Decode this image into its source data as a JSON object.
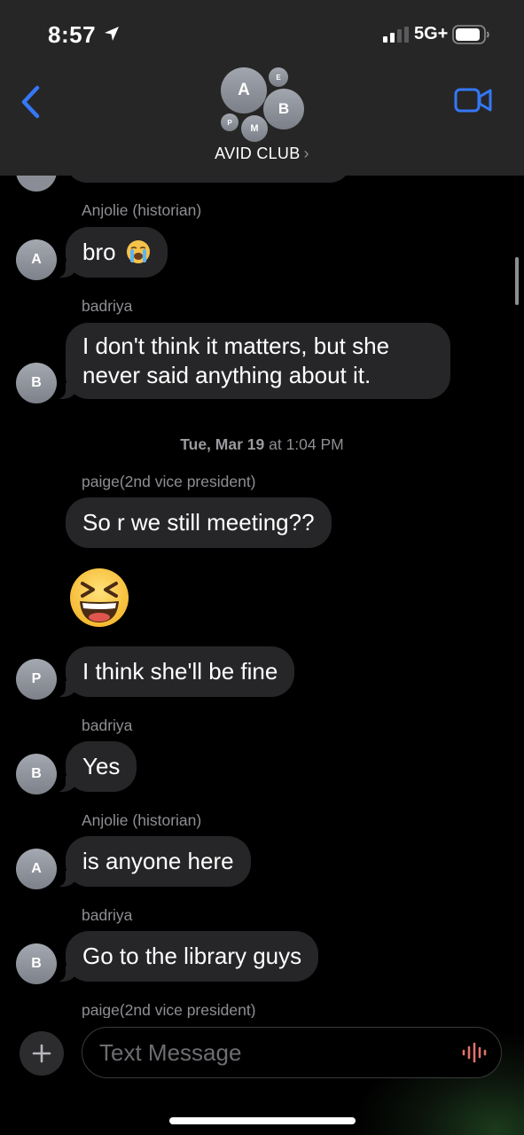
{
  "status_bar": {
    "time": "8:57",
    "network": "5G+",
    "icons": [
      "location-arrow-icon",
      "signal-bars-icon",
      "battery-icon"
    ]
  },
  "header": {
    "group_name": "AVID CLUB",
    "chevron": "›",
    "avatar_initials": [
      "A",
      "E",
      "B",
      "P",
      "M"
    ],
    "accent_color": "#3478f6"
  },
  "messages": [
    {
      "sender": "Anjolie (historian)",
      "avatar": "A",
      "text": "bro",
      "emoji": "loudly-crying-face"
    },
    {
      "sender": "badriya",
      "avatar": "B",
      "text": "I don't think it matters, but she never said anything about it."
    },
    {
      "timestamp_day": "Tue, Mar 19",
      "timestamp_time": "at 1:04 PM"
    },
    {
      "sender": "paige(2nd vice president)",
      "text": "So r we still meeting??"
    },
    {
      "emoji": "grinning-squinting-face"
    },
    {
      "avatar": "P",
      "text": "I think she'll be fine"
    },
    {
      "sender": "badriya",
      "avatar": "B",
      "text": "Yes"
    },
    {
      "sender": "Anjolie (historian)",
      "avatar": "A",
      "text": "is anyone here"
    },
    {
      "sender": "badriya",
      "avatar": "B",
      "text": "Go to the library guys"
    },
    {
      "sender": "paige(2nd vice president)"
    }
  ],
  "composer": {
    "placeholder": "Text Message",
    "plus_icon": "plus-icon",
    "audio_icon": "audio-waveform-icon",
    "audio_color": "#e0736a"
  },
  "colors": {
    "background": "#000000",
    "bubble": "#262628",
    "header": "#262626",
    "secondary_text": "#8e8e93"
  }
}
